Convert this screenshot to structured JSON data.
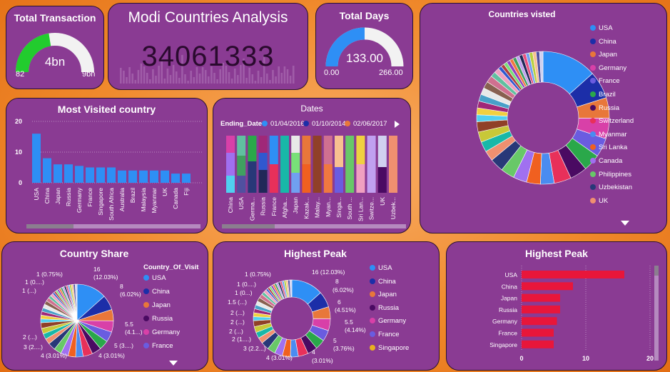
{
  "total_transaction": {
    "title": "Total Transaction",
    "value": "4bn",
    "min": "82",
    "max": "9bn",
    "fill": 0.45
  },
  "header": {
    "title": "Modi Countries Analysis",
    "value": "34061333"
  },
  "total_days": {
    "title": "Total Days",
    "value": "133.00",
    "min": "0.00",
    "max": "266.00",
    "fill": 0.5
  },
  "countries_visited": {
    "title": "Countries visted",
    "legend": [
      {
        "label": "USA",
        "color": "#2e8ff5"
      },
      {
        "label": "China",
        "color": "#1c2ea8"
      },
      {
        "label": "Japan",
        "color": "#e8773a"
      },
      {
        "label": "Germany",
        "color": "#d840a8"
      },
      {
        "label": "France",
        "color": "#6a5ce0"
      },
      {
        "label": "Brazil",
        "color": "#2aa84a"
      },
      {
        "label": "Russia",
        "color": "#4a0a62"
      },
      {
        "label": "Switzerland",
        "color": "#e8305a"
      },
      {
        "label": "Myanmar",
        "color": "#4a8cf0"
      },
      {
        "label": "Sri Lanka",
        "color": "#f06020"
      },
      {
        "label": "Canada",
        "color": "#a070f0"
      },
      {
        "label": "Philippines",
        "color": "#68c868"
      },
      {
        "label": "Uzbekistan",
        "color": "#283878"
      },
      {
        "label": "UK",
        "color": "#f09070"
      }
    ]
  },
  "most_visited": {
    "title": "Most Visited country",
    "chart_data": {
      "type": "bar",
      "categories": [
        "USA",
        "China",
        "Japan",
        "Russia",
        "Germany",
        "France",
        "Singapore",
        "South Africa",
        "Australia",
        "Brazil",
        "Malaysia",
        "Myanmar",
        "UK",
        "Canada",
        "Fiji"
      ],
      "values": [
        16,
        8,
        6,
        6,
        5.5,
        5,
        5,
        5,
        4,
        4,
        4,
        4,
        4,
        3,
        3
      ],
      "ylim": [
        0,
        20
      ],
      "yticks": [
        "0",
        "10",
        "20"
      ],
      "color": "#2e8ff5"
    }
  },
  "dates": {
    "title": "Dates",
    "legend_title": "Ending_Date",
    "legend": [
      {
        "label": "01/04/2016",
        "color": "#2e8ff5"
      },
      {
        "label": "01/10/2014",
        "color": "#1c2ea8"
      },
      {
        "label": "02/06/2017",
        "color": "#e8773a"
      }
    ],
    "categories": [
      "China",
      "USA",
      "Germa...",
      "Russia",
      "France",
      "Afgha...",
      "Japan",
      "Kazak...",
      "Malay...",
      "Myan...",
      "Singa...",
      "South ...",
      "Sri Lan...",
      "Switze...",
      "UK",
      "Uzbek..."
    ]
  },
  "country_share": {
    "title": "Country Share",
    "legend_title": "Country_Of_Visit",
    "legend": [
      {
        "label": "USA",
        "color": "#2e8ff5"
      },
      {
        "label": "China",
        "color": "#1c2ea8"
      },
      {
        "label": "Japan",
        "color": "#e8773a"
      },
      {
        "label": "Russia",
        "color": "#4a0a62"
      },
      {
        "label": "Germany",
        "color": "#d840a8"
      },
      {
        "label": "France",
        "color": "#6a5ce0"
      }
    ],
    "labels": [
      "16",
      "(12.03%)",
      "8",
      "(6.02%)",
      "5.5",
      "(4.1...)",
      "5 (3....)",
      "4 (3.01%)",
      "4 (3.01%)",
      "3 (2....)",
      "2 (...)",
      "1 (...)",
      "1 (0....)",
      "1 (0.75%)"
    ]
  },
  "highest_peak_pie": {
    "title": "Highest Peak",
    "legend": [
      {
        "label": "USA",
        "color": "#2e8ff5"
      },
      {
        "label": "China",
        "color": "#1c2ea8"
      },
      {
        "label": "Japan",
        "color": "#e8773a"
      },
      {
        "label": "Russia",
        "color": "#4a0a62"
      },
      {
        "label": "Germany",
        "color": "#d840a8"
      },
      {
        "label": "France",
        "color": "#6a5ce0"
      },
      {
        "label": "Singapore",
        "color": "#e8b020"
      }
    ],
    "labels": [
      "16 (12.03%)",
      "8",
      "(6.02%)",
      "6",
      "(4.51%)",
      "5.5",
      "(4.14%)",
      "5",
      "(3.76%)",
      "4",
      "(3.01%)",
      "4 (3.01%)",
      "3 (2.2...)",
      "2 (1....)",
      "2 (...)",
      "2 (...)",
      "2 (...)",
      "1.5 (...)",
      "1 (0...)",
      "1 (0....)",
      "1 (0.75%)"
    ]
  },
  "highest_peak_bar": {
    "title": "Highest Peak",
    "chart_data": {
      "type": "bar",
      "categories": [
        "USA",
        "China",
        "Japan",
        "Russia",
        "Germany",
        "France",
        "Singapore"
      ],
      "values": [
        16,
        8,
        6,
        6,
        5.5,
        5,
        5
      ],
      "xlim": [
        0,
        20
      ],
      "xticks": [
        "0",
        "10",
        "20"
      ],
      "color": "#e8163a"
    }
  }
}
